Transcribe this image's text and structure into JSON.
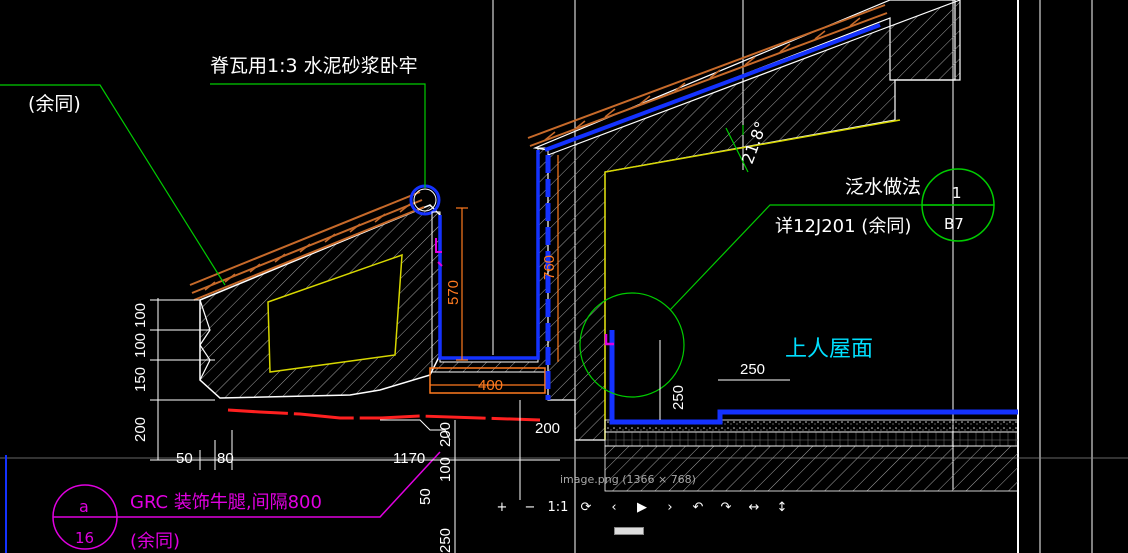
{
  "colors": {
    "background": "#000000",
    "white_lines": "#ffffff",
    "green_leaders": "#00cc00",
    "tile_orange": "#c76a2a",
    "waterproof_blue": "#1432ff",
    "dimension_orange": "#ff7a1f",
    "magenta_note": "#e000e0",
    "cyan_label": "#00e0ff",
    "yellow_outline": "#d8d800",
    "red_line": "#ff2020",
    "hatch_gray": "#a0a0a0"
  },
  "labels": {
    "ridge_tile_note": "脊瓦用1:3  水泥砂浆卧牢",
    "same_left": "(余同)",
    "flashing_title": "泛水做法",
    "flashing_ref": "详12J201  (余同)",
    "roof_name": "上人屋面",
    "angle": "21.8°",
    "grc_note": "GRC  装饰牛腿,间隔800",
    "grc_same": "(余同)"
  },
  "detail_bubbles": {
    "right": {
      "top": "1",
      "bottom": "B7"
    },
    "left": {
      "top": "a",
      "bottom": "16"
    }
  },
  "dimensions": {
    "height_570": "570",
    "height_760": "760",
    "width_400": "400",
    "d250_horizontal": "250",
    "d250_vertical": "250",
    "d200_right": "200",
    "d200_gutter": "200",
    "stack_100_a": "100",
    "stack_100_b": "100",
    "stack_150": "150",
    "stack_200": "200",
    "bottom_50": "50",
    "bottom_80": "80",
    "bottom_1170": "1170",
    "vert_100": "100",
    "vert_50": "50",
    "vert_250": "250"
  },
  "viewer": {
    "caption": "image.png (1366 × 768)",
    "buttons": [
      {
        "name": "zoom-in-button",
        "glyph": "+"
      },
      {
        "name": "zoom-out-button",
        "glyph": "−"
      },
      {
        "name": "actual-size-button",
        "glyph": "1:1"
      },
      {
        "name": "fit-screen-button",
        "glyph": "⟳"
      },
      {
        "name": "prev-image-button",
        "glyph": "‹"
      },
      {
        "name": "play-slideshow-button",
        "glyph": "▶"
      },
      {
        "name": "next-image-button",
        "glyph": "›"
      },
      {
        "name": "rotate-left-button",
        "glyph": "↶"
      },
      {
        "name": "rotate-right-button",
        "glyph": "↷"
      },
      {
        "name": "flip-horizontal-button",
        "glyph": "↔"
      },
      {
        "name": "flip-vertical-button",
        "glyph": "↕"
      }
    ]
  }
}
